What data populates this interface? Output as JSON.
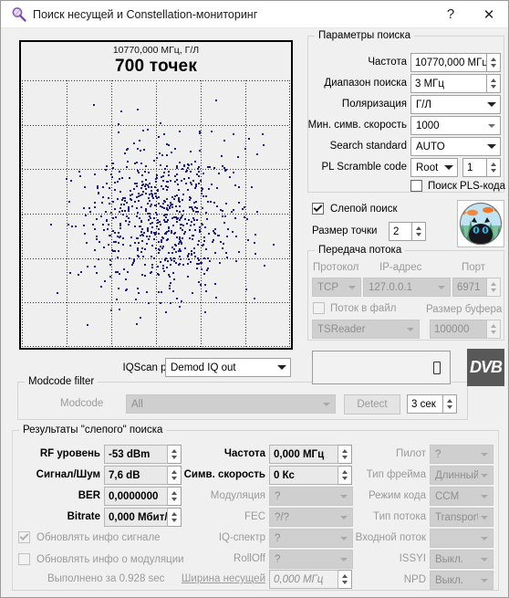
{
  "window": {
    "title": "Поиск несущей и Constellation-мониторинг",
    "icon": "magnifier-icon",
    "help_label": "?",
    "close_label": "✕"
  },
  "constellation": {
    "frequency_label": "10770,000 МГц, Г/Л",
    "points_label": "700 точек",
    "grid_divisions": 6
  },
  "iqscan": {
    "label": "IQScan point",
    "value": "Demod IQ out"
  },
  "modcode_filter": {
    "title": "Modcode filter",
    "label": "Modcode",
    "value": "All",
    "detect_label": "Detect",
    "timeout_value": "3 сек"
  },
  "search_params": {
    "title": "Параметры поиска",
    "rows": [
      {
        "label": "Частота",
        "value": "10770,000 МГц",
        "type": "spin"
      },
      {
        "label": "Диапазон поиска",
        "value": "3 МГц",
        "type": "spin"
      },
      {
        "label": "Поляризация",
        "value": "Г/Л",
        "type": "combo"
      },
      {
        "label": "Мин. симв. скорость",
        "value": "1000",
        "type": "combo-thin"
      },
      {
        "label": "Search standard",
        "value": "AUTO",
        "type": "combo"
      }
    ],
    "pl_scramble": {
      "label": "PL Scramble code",
      "mode": "Root",
      "value": "1"
    },
    "pls_search": {
      "label": "Поиск PLS-кода",
      "checked": false
    }
  },
  "blind_search": {
    "label": "Слепой поиск",
    "checked": true,
    "dot_size_label": "Размер точки",
    "dot_size_value": "2"
  },
  "stream": {
    "title": "Передача потока",
    "protocol_label": "Протокол",
    "protocol_value": "TCP",
    "ip_label": "IP-адрес",
    "ip_value": "127.0.0.1",
    "port_label": "Порт",
    "port_value": "6971",
    "to_file_label": "Поток в файл",
    "to_file_checked": false,
    "buffer_label": "Размер буфера",
    "buffer_value": "100000",
    "target_value": "TSReader"
  },
  "results": {
    "title": "Результаты \"слепого\" поиска",
    "col1": [
      {
        "label": "RF уровень",
        "value": "-53 dBm",
        "bold": true
      },
      {
        "label": "Сигнал/Шум",
        "value": "7,6 dB",
        "bold": true
      },
      {
        "label": "BER",
        "value": "0,0000000",
        "bold": true
      },
      {
        "label": "Bitrate",
        "value": "0,000 Мбит/",
        "bold": true
      }
    ],
    "checkboxes": [
      {
        "label": "Обновлять инфо сигнале",
        "checked": true
      },
      {
        "label": "Обновлять инфо о модуляции",
        "checked": false
      }
    ],
    "status_text": "Выполнено за 0.928 sec",
    "col2": [
      {
        "label": "Частота",
        "value": "0,000 МГц",
        "type": "spin-val"
      },
      {
        "label": "Симв. скорость",
        "value": "0 Кс",
        "type": "spin-val"
      },
      {
        "label": "Модуляция",
        "value": "?",
        "type": "combo-dis"
      },
      {
        "label": "FEC",
        "value": "?/?",
        "type": "combo-dis"
      },
      {
        "label": "IQ-спектр",
        "value": "?",
        "type": "combo-dis"
      },
      {
        "label": "RollOff",
        "value": "?",
        "type": "combo-dis"
      },
      {
        "label": "Ширина несущей",
        "value": "0,000 МГц",
        "type": "spin-ro",
        "link": true
      }
    ],
    "col3": [
      {
        "label": "Пилот",
        "value": "?"
      },
      {
        "label": "Тип фрейма",
        "value": "Длинный"
      },
      {
        "label": "Режим кода",
        "value": "CCM"
      },
      {
        "label": "Тип потока",
        "value": "Transport"
      },
      {
        "label": "Входной поток",
        "value": ""
      },
      {
        "label": "ISSYI",
        "value": "Выкл."
      },
      {
        "label": "NPD",
        "value": "Выкл."
      }
    ]
  },
  "logo": {
    "dvb_text": "DVB"
  },
  "colors": {
    "point": "#1a1a8c",
    "window_bg": "#f0f0f0",
    "titlebar_bg": "#ffffff"
  }
}
